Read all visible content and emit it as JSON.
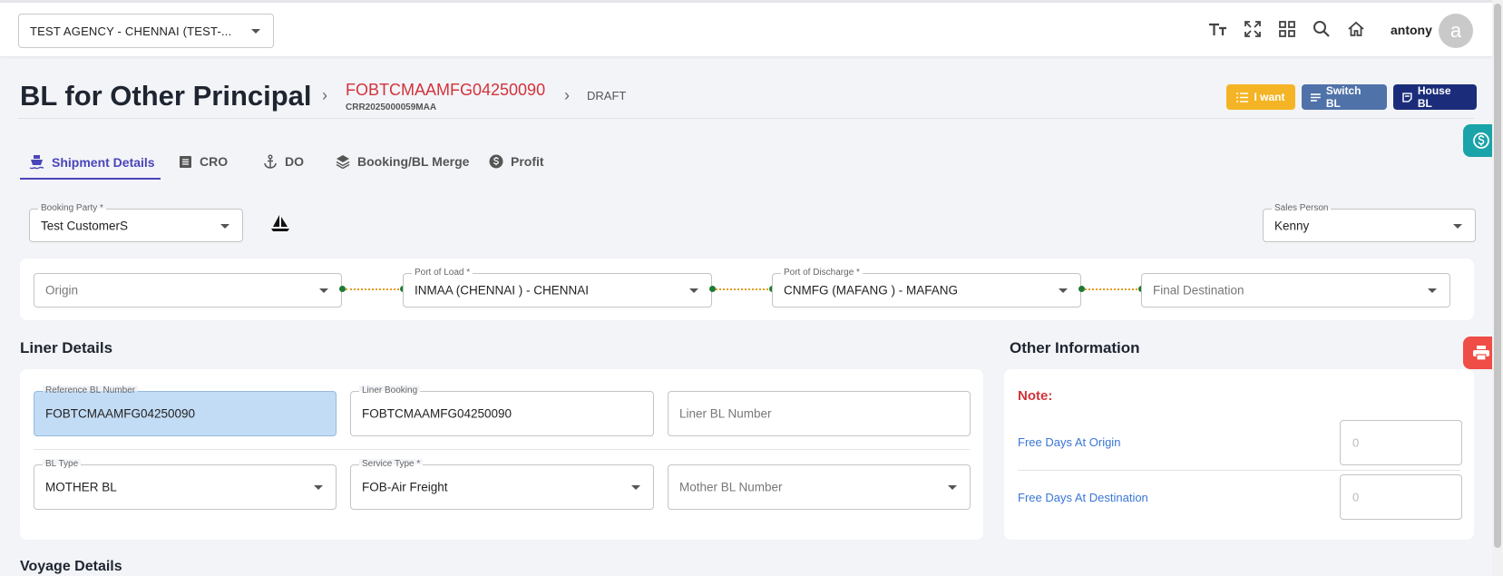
{
  "topbar": {
    "agency": "TEST AGENCY - CHENNAI  (TEST-...",
    "icons": [
      "text-size-icon",
      "fullscreen-icon",
      "apps-icon",
      "search-icon",
      "home-icon"
    ],
    "username": "antony",
    "avatar_letter": "a"
  },
  "header": {
    "title": "BL for Other Principal",
    "bl_number": "FOBTCMAAMFG04250090",
    "bl_sub": "CRR2025000059MAA",
    "status": "DRAFT",
    "buttons": {
      "i_want": "I want",
      "switch_bl": "Switch BL",
      "house_bl": "House BL"
    }
  },
  "tabs": [
    {
      "label": "Shipment Details",
      "icon": "ship-icon"
    },
    {
      "label": "CRO",
      "icon": "list-icon"
    },
    {
      "label": "DO",
      "icon": "anchor-icon"
    },
    {
      "label": "Booking/BL Merge",
      "icon": "layers-icon"
    },
    {
      "label": "Profit",
      "icon": "dollar-icon"
    }
  ],
  "booking_party": {
    "label": "Booking Party *",
    "value": "Test CustomerS"
  },
  "sales_person": {
    "label": "Sales Person",
    "value": "Kenny"
  },
  "route": {
    "origin": {
      "placeholder": "Origin"
    },
    "port_of_load": {
      "label": "Port of Load *",
      "value": "INMAA (CHENNAI ) - CHENNAI"
    },
    "port_of_discharge": {
      "label": "Port of Discharge *",
      "value": "CNMFG (MAFANG ) - MAFANG"
    },
    "final_destination": {
      "placeholder": "Final Destination"
    }
  },
  "liner": {
    "title": "Liner Details",
    "reference_bl": {
      "label": "Reference BL Number",
      "value": "FOBTCMAAMFG04250090"
    },
    "liner_booking": {
      "label": "Liner Booking",
      "value": "FOBTCMAAMFG04250090"
    },
    "liner_bl_number": {
      "placeholder": "Liner BL Number"
    },
    "bl_type": {
      "label": "BL Type",
      "value": "MOTHER BL"
    },
    "service_type": {
      "label": "Service Type *",
      "value": "FOB-Air Freight"
    },
    "mother_bl_number": {
      "placeholder": "Mother BL Number"
    }
  },
  "other_info": {
    "title": "Other Information",
    "note": "Note:",
    "free_days_origin": {
      "label": "Free Days At Origin",
      "placeholder": "0"
    },
    "free_days_destination": {
      "label": "Free Days At Destination",
      "placeholder": "0"
    }
  },
  "voyage": {
    "title": "Voyage Details"
  },
  "colors": {
    "accent": "#4a45b8",
    "danger": "#d3333b",
    "warning": "#f5b425",
    "switch": "#4f72a8",
    "navy": "#1b2d7a",
    "link": "#3a76d6"
  }
}
